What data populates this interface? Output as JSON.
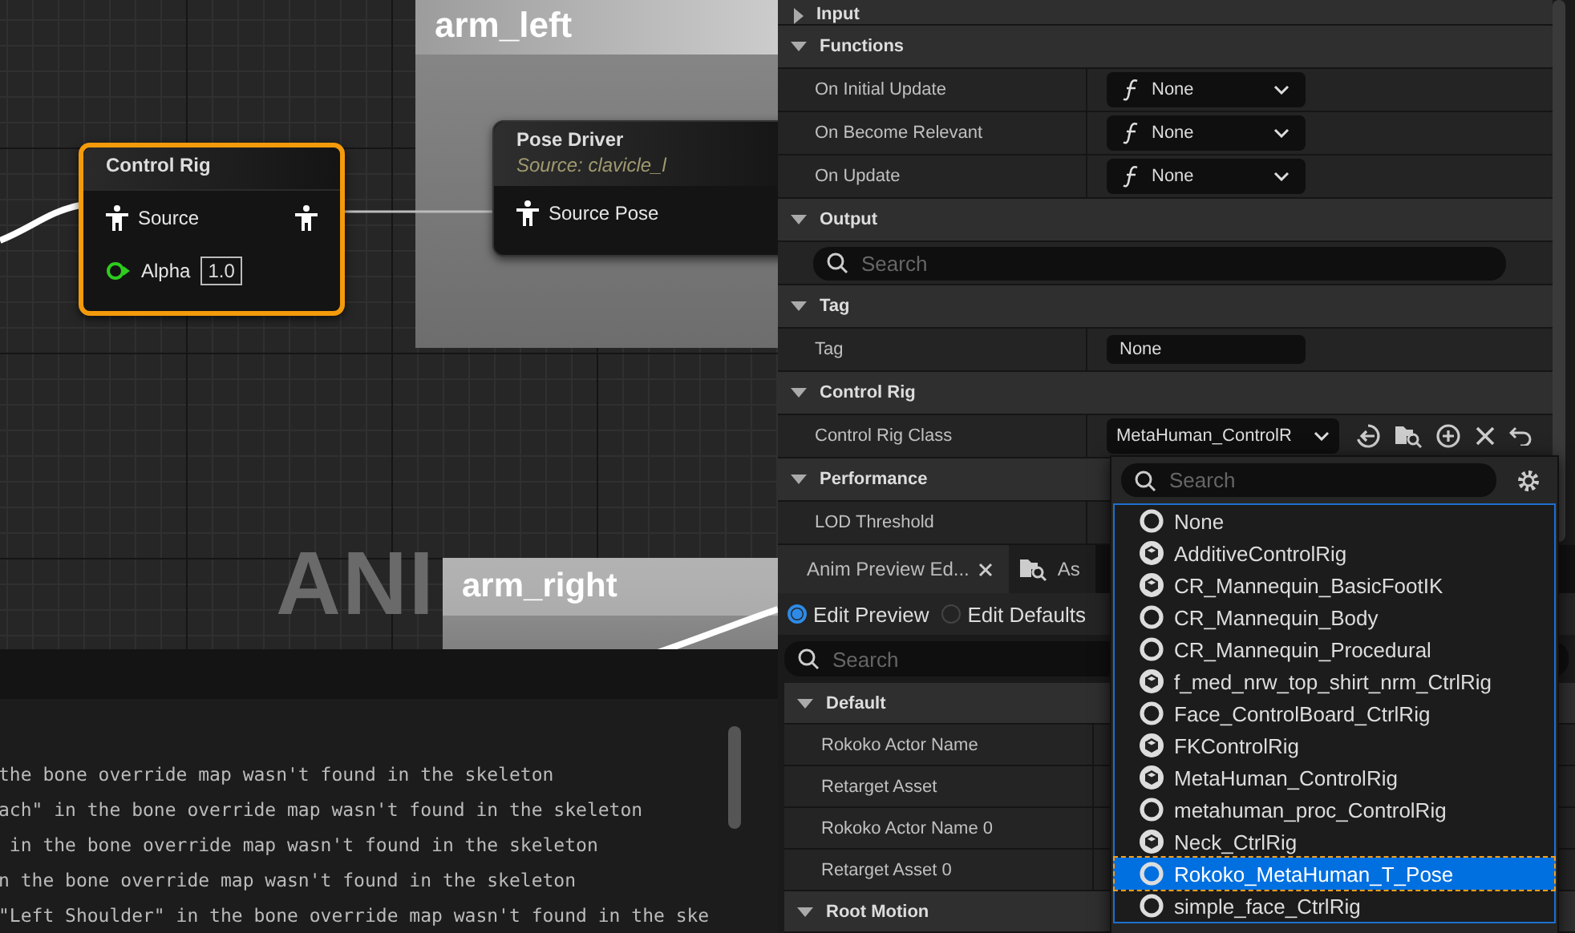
{
  "graph": {
    "background_label": "ANI",
    "comments": [
      {
        "title": "arm_left"
      },
      {
        "title": "arm_right"
      }
    ],
    "control_rig_node": {
      "title": "Control Rig",
      "selected": true,
      "pin": "Source",
      "alpha_label": "Alpha",
      "alpha_value": "1.0"
    },
    "pose_driver_node": {
      "title": "Pose Driver",
      "subtitle": "Source: clavicle_l",
      "pin": "Source Pose"
    }
  },
  "log": {
    "lines": [
      "the bone override map wasn't found in the skeleton",
      "ach\" in the bone override map wasn't found in the skeleton",
      " in the bone override map wasn't found in the skeleton",
      "n the bone override map wasn't found in the skeleton",
      "\"Left Shoulder\" in the bone override map wasn't found in the ske"
    ]
  },
  "details": [
    {
      "kind": "section",
      "label": "Input",
      "expanded": false
    },
    {
      "kind": "section",
      "label": "Functions",
      "expanded": true
    },
    {
      "kind": "function",
      "label": "On Initial Update",
      "value": "None"
    },
    {
      "kind": "function",
      "label": "On Become Relevant",
      "value": "None"
    },
    {
      "kind": "function",
      "label": "On Update",
      "value": "None"
    },
    {
      "kind": "section",
      "label": "Output",
      "expanded": true
    },
    {
      "kind": "search",
      "placeholder": "Search"
    },
    {
      "kind": "section",
      "label": "Tag",
      "expanded": true
    },
    {
      "kind": "text",
      "label": "Tag",
      "value": "None"
    },
    {
      "kind": "section",
      "label": "Control Rig",
      "expanded": true
    },
    {
      "kind": "class",
      "label": "Control Rig Class",
      "value": "MetaHuman_ControlR"
    },
    {
      "kind": "section",
      "label": "Performance",
      "expanded": true
    },
    {
      "kind": "label",
      "label": "LOD Threshold"
    }
  ],
  "preview_panel": {
    "tabs": [
      {
        "label": "Anim Preview Ed...",
        "selected": true,
        "closable": true
      },
      {
        "label": "As",
        "selected": false,
        "closable": false
      }
    ],
    "modes": [
      {
        "label": "Edit Preview",
        "selected": true
      },
      {
        "label": "Edit Defaults",
        "selected": false
      }
    ],
    "search": {
      "placeholder": "Search"
    },
    "rows": [
      {
        "kind": "section",
        "label": "Default",
        "expanded": true
      },
      {
        "kind": "label",
        "label": "Rokoko Actor Name"
      },
      {
        "kind": "label",
        "label": "Retarget Asset"
      },
      {
        "kind": "label",
        "label": "Rokoko Actor Name 0"
      },
      {
        "kind": "label",
        "label": "Retarget Asset 0"
      },
      {
        "kind": "section",
        "label": "Root Motion",
        "expanded": true
      }
    ]
  },
  "class_picker": {
    "search": {
      "placeholder": "Search"
    },
    "items": [
      {
        "label": "None",
        "kind": "ring",
        "selected": false
      },
      {
        "label": "AdditiveControlRig",
        "kind": "rig",
        "selected": false
      },
      {
        "label": "CR_Mannequin_BasicFootIK",
        "kind": "rig",
        "selected": false
      },
      {
        "label": "CR_Mannequin_Body",
        "kind": "ring",
        "selected": false
      },
      {
        "label": "CR_Mannequin_Procedural",
        "kind": "ring",
        "selected": false
      },
      {
        "label": "f_med_nrw_top_shirt_nrm_CtrlRig",
        "kind": "rig",
        "selected": false
      },
      {
        "label": "Face_ControlBoard_CtrlRig",
        "kind": "ring",
        "selected": false
      },
      {
        "label": "FKControlRig",
        "kind": "rig",
        "selected": false
      },
      {
        "label": "MetaHuman_ControlRig",
        "kind": "rig",
        "selected": false
      },
      {
        "label": "metahuman_proc_ControlRig",
        "kind": "ring",
        "selected": false
      },
      {
        "label": "Neck_CtrlRig",
        "kind": "rig",
        "selected": false
      },
      {
        "label": "Rokoko_MetaHuman_T_Pose",
        "kind": "ring",
        "selected": true
      },
      {
        "label": "simple_face_CtrlRig",
        "kind": "ring",
        "selected": false
      }
    ]
  }
}
